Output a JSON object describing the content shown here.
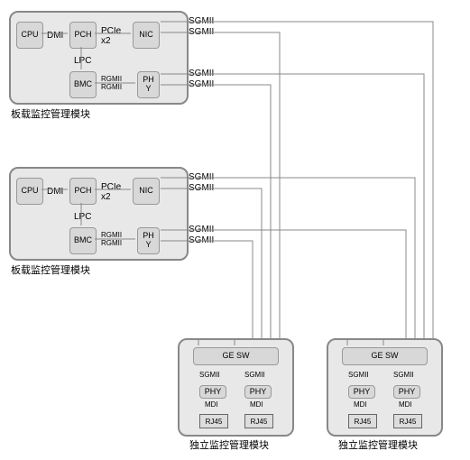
{
  "board1": {
    "cpu": "CPU",
    "dmi": "DMI",
    "pch": "PCH",
    "pcie": "PCIe\nx2",
    "nic": "NIC",
    "lpc": "LPC",
    "bmc": "BMC",
    "rgmii": "RGMII\nRGMII",
    "phy": "PH\nY",
    "caption": "板载监控管理模块",
    "sig_top1": "SGMII",
    "sig_top2": "SGMII",
    "sig_bot1": "SGMII",
    "sig_bot2": "SGMII"
  },
  "board2": {
    "cpu": "CPU",
    "dmi": "DMI",
    "pch": "PCH",
    "pcie": "PCIe\nx2",
    "nic": "NIC",
    "lpc": "LPC",
    "bmc": "BMC",
    "rgmii": "RGMII\nRGMII",
    "phy": "PH\nY",
    "caption": "板载监控管理模块",
    "sig_top1": "SGMII",
    "sig_top2": "SGMII",
    "sig_bot1": "SGMII",
    "sig_bot2": "SGMII"
  },
  "switch1": {
    "gesw": "GE SW",
    "sgmii_l": "SGMII",
    "sgmii_r": "SGMII",
    "phy_l": "PHY",
    "phy_r": "PHY",
    "mdi_l": "MDI",
    "mdi_r": "MDI",
    "rj45_l": "RJ45",
    "rj45_r": "RJ45",
    "caption": "独立监控管理模块"
  },
  "switch2": {
    "gesw": "GE SW",
    "sgmii_l": "SGMII",
    "sgmii_r": "SGMII",
    "phy_l": "PHY",
    "phy_r": "PHY",
    "mdi_l": "MDI",
    "mdi_r": "MDI",
    "rj45_l": "RJ45",
    "rj45_r": "RJ45",
    "caption": "独立监控管理模块"
  }
}
